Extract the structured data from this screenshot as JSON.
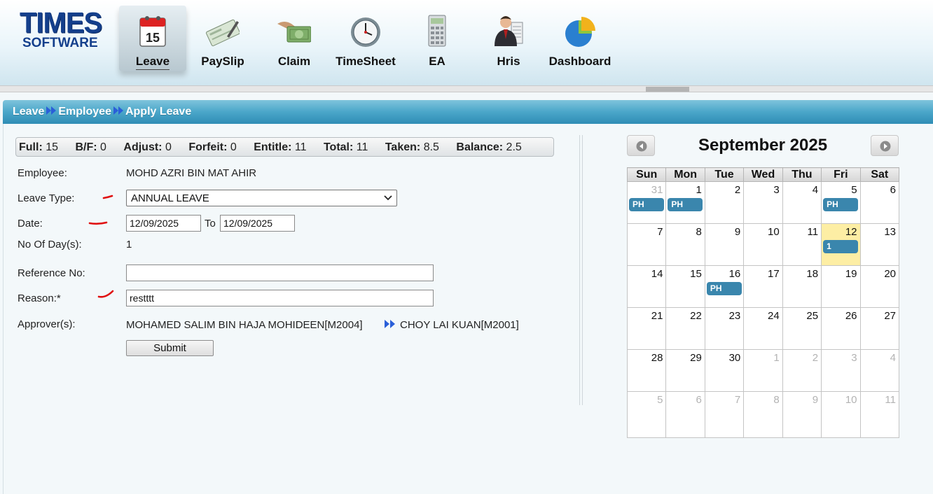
{
  "logo": {
    "line1": "TIMES",
    "line2": "SOFTWARE"
  },
  "nav": [
    {
      "label": "Leave",
      "icon": "calendar-icon",
      "active": true
    },
    {
      "label": "PaySlip",
      "icon": "cheque-icon"
    },
    {
      "label": "Claim",
      "icon": "money-hand-icon"
    },
    {
      "label": "TimeSheet",
      "icon": "clock-icon"
    },
    {
      "label": "EA",
      "icon": "calculator-icon"
    },
    {
      "label": "Hris",
      "icon": "person-icon"
    },
    {
      "label": "Dashboard",
      "icon": "pie-chart-icon"
    }
  ],
  "breadcrumb": [
    "Leave",
    "Employee",
    "Apply Leave"
  ],
  "summary": [
    {
      "label": "Full:",
      "value": "15"
    },
    {
      "label": "B/F:",
      "value": "0"
    },
    {
      "label": "Adjust:",
      "value": "0"
    },
    {
      "label": "Forfeit:",
      "value": "0"
    },
    {
      "label": "Entitle:",
      "value": "11"
    },
    {
      "label": "Total:",
      "value": "11"
    },
    {
      "label": "Taken:",
      "value": "8.5"
    },
    {
      "label": "Balance:",
      "value": "2.5"
    }
  ],
  "form": {
    "employee_label": "Employee:",
    "employee_value": "MOHD AZRI BIN MAT AHIR",
    "leave_type_label": "Leave Type:",
    "leave_type_value": "ANNUAL LEAVE",
    "date_label": "Date:",
    "date_from": "12/09/2025",
    "date_to_label": "To",
    "date_to": "12/09/2025",
    "days_label": "No Of Day(s):",
    "days_value": "1",
    "reference_label": "Reference No:",
    "reference_value": "",
    "reason_label": "Reason:*",
    "reason_value": "restttt",
    "approvers_label": "Approver(s):",
    "approver1": "MOHAMED SALIM BIN HAJA MOHIDEEN[M2004]",
    "approver2": "CHOY LAI KUAN[M2001]",
    "submit_label": "Submit"
  },
  "calendar": {
    "title": "September 2025",
    "weekdays": [
      "Sun",
      "Mon",
      "Tue",
      "Wed",
      "Thu",
      "Fri",
      "Sat"
    ],
    "weeks": [
      [
        {
          "d": "31",
          "other": true,
          "ev": "PH"
        },
        {
          "d": "1",
          "ev": "PH"
        },
        {
          "d": "2"
        },
        {
          "d": "3"
        },
        {
          "d": "4"
        },
        {
          "d": "5",
          "ev": "PH"
        },
        {
          "d": "6"
        }
      ],
      [
        {
          "d": "7"
        },
        {
          "d": "8"
        },
        {
          "d": "9"
        },
        {
          "d": "10"
        },
        {
          "d": "11"
        },
        {
          "d": "12",
          "today": true,
          "ev": "1"
        },
        {
          "d": "13"
        }
      ],
      [
        {
          "d": "14"
        },
        {
          "d": "15"
        },
        {
          "d": "16",
          "ev": "PH"
        },
        {
          "d": "17"
        },
        {
          "d": "18"
        },
        {
          "d": "19"
        },
        {
          "d": "20"
        }
      ],
      [
        {
          "d": "21"
        },
        {
          "d": "22"
        },
        {
          "d": "23"
        },
        {
          "d": "24"
        },
        {
          "d": "25"
        },
        {
          "d": "26"
        },
        {
          "d": "27"
        }
      ],
      [
        {
          "d": "28"
        },
        {
          "d": "29"
        },
        {
          "d": "30"
        },
        {
          "d": "1",
          "other": true
        },
        {
          "d": "2",
          "other": true
        },
        {
          "d": "3",
          "other": true
        },
        {
          "d": "4",
          "other": true
        }
      ],
      [
        {
          "d": "5",
          "other": true
        },
        {
          "d": "6",
          "other": true
        },
        {
          "d": "7",
          "other": true
        },
        {
          "d": "8",
          "other": true
        },
        {
          "d": "9",
          "other": true
        },
        {
          "d": "10",
          "other": true
        },
        {
          "d": "11",
          "other": true
        }
      ]
    ]
  },
  "colors": {
    "accent": "#3a86ad",
    "today": "#fdeea4",
    "header": "#2f8db5"
  }
}
